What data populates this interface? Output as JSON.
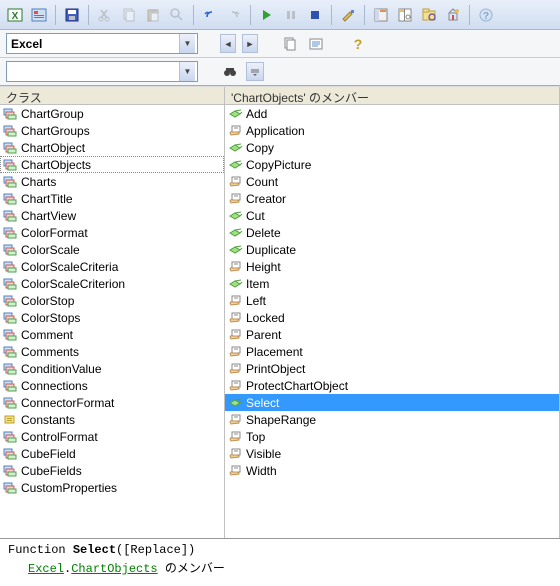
{
  "toolbar": {
    "combo_value": "Excel",
    "search_value": ""
  },
  "left": {
    "header": "クラス",
    "items": [
      "ChartGroup",
      "ChartGroups",
      "ChartObject",
      "ChartObjects",
      "Charts",
      "ChartTitle",
      "ChartView",
      "ColorFormat",
      "ColorScale",
      "ColorScaleCriteria",
      "ColorScaleCriterion",
      "ColorStop",
      "ColorStops",
      "Comment",
      "Comments",
      "ConditionValue",
      "Connections",
      "ConnectorFormat",
      "Constants",
      "ControlFormat",
      "CubeField",
      "CubeFields",
      "CustomProperties"
    ],
    "active": "ChartObjects"
  },
  "right": {
    "header": "'ChartObjects' のメンバー",
    "items": [
      {
        "n": "Add",
        "t": "m"
      },
      {
        "n": "Application",
        "t": "p"
      },
      {
        "n": "Copy",
        "t": "m"
      },
      {
        "n": "CopyPicture",
        "t": "m"
      },
      {
        "n": "Count",
        "t": "p"
      },
      {
        "n": "Creator",
        "t": "p"
      },
      {
        "n": "Cut",
        "t": "m"
      },
      {
        "n": "Delete",
        "t": "m"
      },
      {
        "n": "Duplicate",
        "t": "m"
      },
      {
        "n": "Height",
        "t": "p"
      },
      {
        "n": "Item",
        "t": "m"
      },
      {
        "n": "Left",
        "t": "p"
      },
      {
        "n": "Locked",
        "t": "p"
      },
      {
        "n": "Parent",
        "t": "p"
      },
      {
        "n": "Placement",
        "t": "p"
      },
      {
        "n": "PrintObject",
        "t": "p"
      },
      {
        "n": "ProtectChartObject",
        "t": "p"
      },
      {
        "n": "Select",
        "t": "m"
      },
      {
        "n": "ShapeRange",
        "t": "p"
      },
      {
        "n": "Top",
        "t": "p"
      },
      {
        "n": "Visible",
        "t": "p"
      },
      {
        "n": "Width",
        "t": "p"
      }
    ],
    "selected": "Select"
  },
  "status": {
    "signature_prefix": "Function ",
    "signature_name": "Select",
    "signature_args": "([Replace])",
    "link1": "Excel",
    "link2": "ChartObjects",
    "suffix": " のメンバー"
  }
}
